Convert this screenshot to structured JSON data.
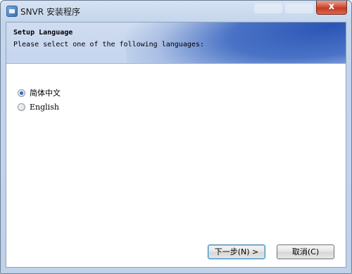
{
  "window": {
    "title": "SNVR 安装程序",
    "close_label": "x"
  },
  "header": {
    "title": "Setup Language",
    "subtitle": "Please select one of the following languages:"
  },
  "languages": [
    {
      "label": "简体中文",
      "selected": true
    },
    {
      "label": "English",
      "selected": false
    }
  ],
  "buttons": {
    "next": "下一步(N) >",
    "cancel": "取消(C)"
  }
}
